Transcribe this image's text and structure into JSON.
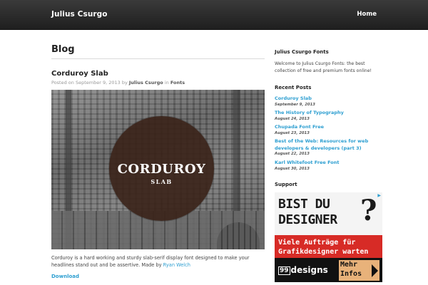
{
  "header": {
    "site_title": "Julius Csurgo",
    "nav_home": "Home"
  },
  "main": {
    "heading": "Blog",
    "post": {
      "title": "Corduroy Slab",
      "meta_prefix": "Posted on ",
      "date": "September 9, 2013",
      "meta_by": " by ",
      "author": "Julius Csurgo",
      "meta_in": " in ",
      "category": "Fonts",
      "image_title": "CORDUROY",
      "image_subtitle": "SLAB",
      "excerpt_text": "Corduroy is a hard working and sturdy slab-serif display font designed to make your headlines stand out and be assertive. Made by ",
      "excerpt_link": "Ryan Welch",
      "download_label": "Download"
    }
  },
  "sidebar": {
    "about_heading": "Julius Csurgo Fonts",
    "about_text": "Welcome to Julius Csurgo Fonts: the best collection of free and premium fonts online!",
    "recent_heading": "Recent Posts",
    "recent_posts": [
      {
        "title": "Corduroy Slab",
        "date": "September 9, 2013"
      },
      {
        "title": "The History of Typography",
        "date": "August 24, 2013"
      },
      {
        "title": "Chupada Font Free",
        "date": "August 23, 2013"
      },
      {
        "title": "Best of the Web: Resources for web developers & developers (part 3)",
        "date": "August 22, 2013"
      },
      {
        "title": "Karl Whitefoot Free Font",
        "date": "August 30, 2013"
      }
    ],
    "support_heading": "Support",
    "ad": {
      "line1": "BIST DU",
      "line2": "DESIGNER",
      "question_mark": "?",
      "red_line1": "Viele Aufträge für",
      "red_line2": "Grafikdesigner warten",
      "logo_number": "99",
      "logo_text": "designs",
      "more_line1": "Mehr",
      "more_line2": "Infos",
      "choice_icon": "ad-choices-icon"
    }
  },
  "colors": {
    "link": "#2e9fd1",
    "header_bg": "#2a2a2a",
    "ad_red": "#d72b26"
  }
}
